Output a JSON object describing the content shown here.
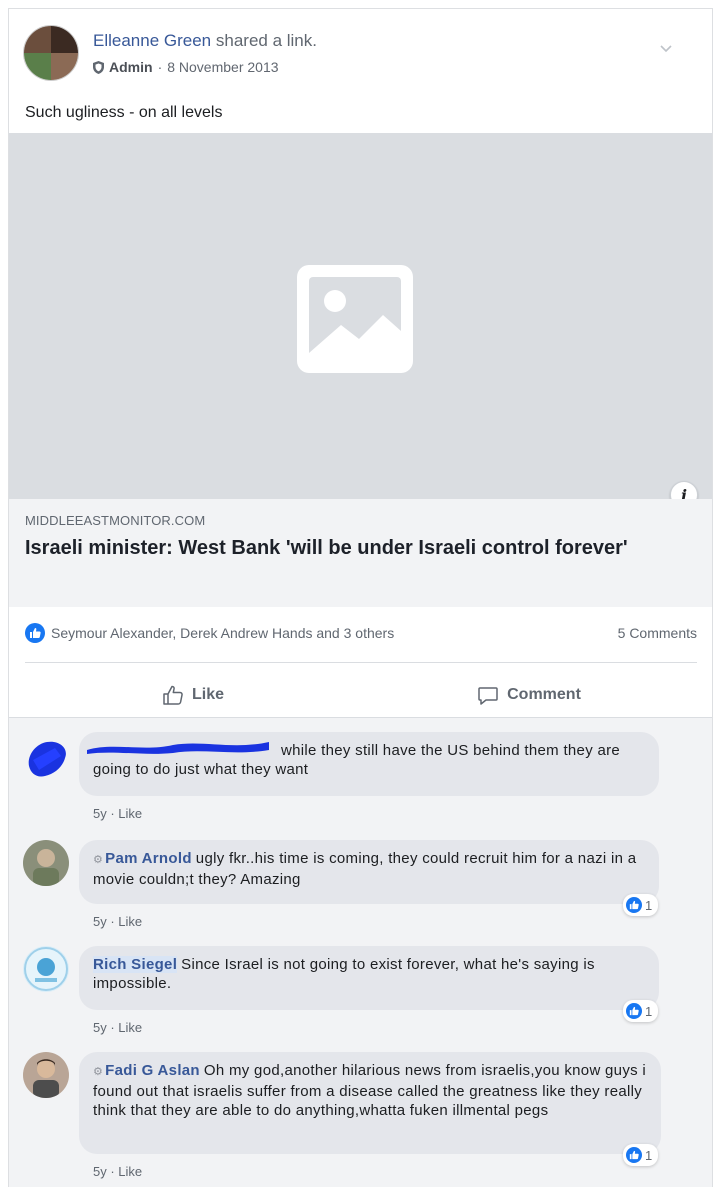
{
  "post": {
    "author": "Elleanne Green",
    "action": "shared a link.",
    "role": "Admin",
    "separator": "·",
    "date": "8 November 2013",
    "text": "Such ugliness - on all levels"
  },
  "link": {
    "domain": "MIDDLEEASTMONITOR.COM",
    "title": "Israeli minister: West Bank 'will be under Israeli control forever'",
    "info_label": "i"
  },
  "reactions": {
    "names": "Seymour Alexander, Derek Andrew Hands and 3 others",
    "comment_count": "5 Comments"
  },
  "actions": {
    "like_label": "Like",
    "comment_label": "Comment"
  },
  "comments": [
    {
      "name": "",
      "text": "while they still have the US behind them they are going to do just what they want",
      "age": "5y",
      "like": "Like",
      "reactions": ""
    },
    {
      "name": "Pam Arnold",
      "text": "ugly fkr..his time is coming, they could recruit him for a nazi in a movie couldn;t they? Amazing",
      "age": "5y",
      "like": "Like",
      "reactions": "1"
    },
    {
      "name": "Rich Siegel",
      "text": "Since Israel is not going to exist forever, what he's saying is impossible.",
      "age": "5y",
      "like": "Like",
      "reactions": "1"
    },
    {
      "name": "Fadi G Aslan",
      "text": "Oh my god,another hilarious news from israelis,you know guys i found out that israelis suffer from a disease called the greatness like they really think that they are able to do anything,whatta fuken illmental pegs",
      "age": "5y",
      "like": "Like",
      "reactions": "1"
    }
  ],
  "colors": {
    "link_blue": "#385898",
    "like_blue": "#1877f2",
    "muted_text": "#606770",
    "bubble_bg": "#e4e6eb"
  }
}
